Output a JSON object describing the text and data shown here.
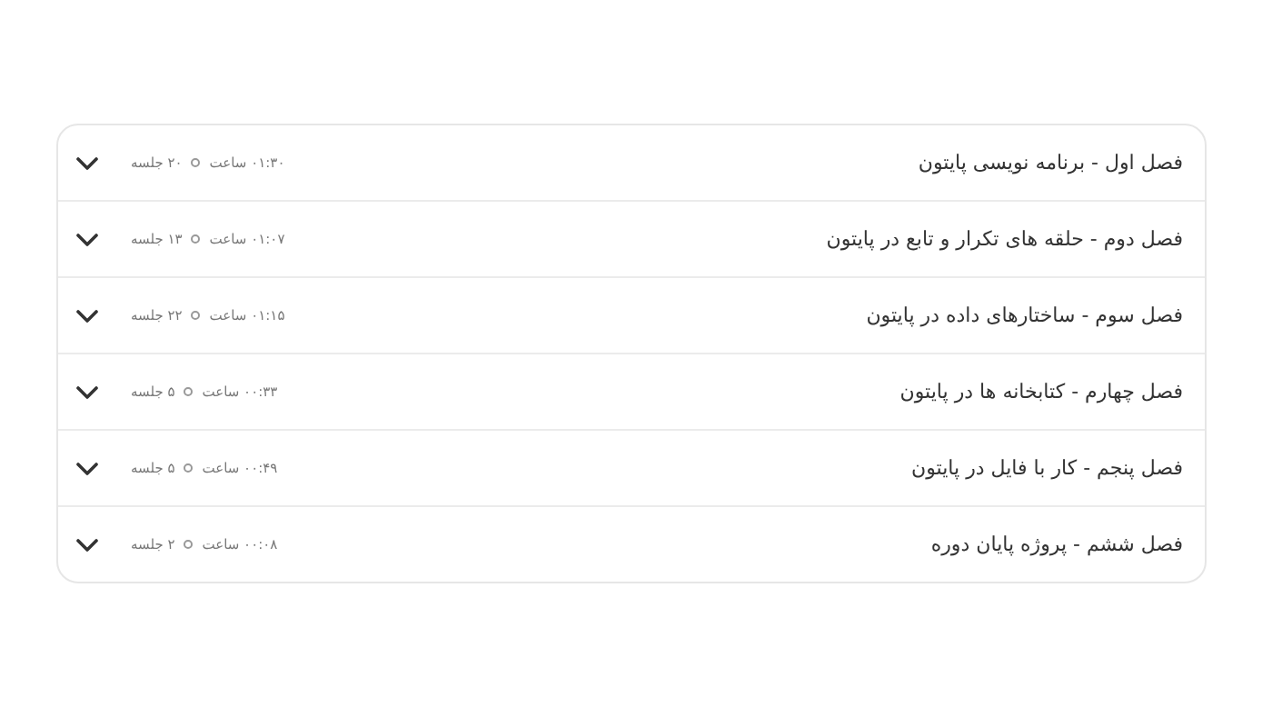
{
  "chapters": [
    {
      "title": "فصل اول - برنامه نویسی پایتون",
      "duration": "۰۱:۳۰ ساعت",
      "sessions": "۲۰ جلسه",
      "expanded": false
    },
    {
      "title": "فصل دوم - حلقه های تکرار و تابع در پایتون",
      "duration": "۰۱:۰۷ ساعت",
      "sessions": "۱۳ جلسه",
      "expanded": false
    },
    {
      "title": "فصل سوم - ساختارهای داده در پایتون",
      "duration": "۰۱:۱۵ ساعت",
      "sessions": "۲۲ جلسه",
      "expanded": false
    },
    {
      "title": "فصل چهارم - کتابخانه ها در پایتون",
      "duration": "۰۰:۳۳ ساعت",
      "sessions": "۵ جلسه",
      "expanded": false
    },
    {
      "title": "فصل پنجم - کار با فایل در پایتون",
      "duration": "۰۰:۴۹ ساعت",
      "sessions": "۵ جلسه",
      "expanded": false
    },
    {
      "title": "فصل ششم - پروژه پایان دوره",
      "duration": "۰۰:۰۸ ساعت",
      "sessions": "۲ جلسه",
      "expanded": false
    }
  ]
}
